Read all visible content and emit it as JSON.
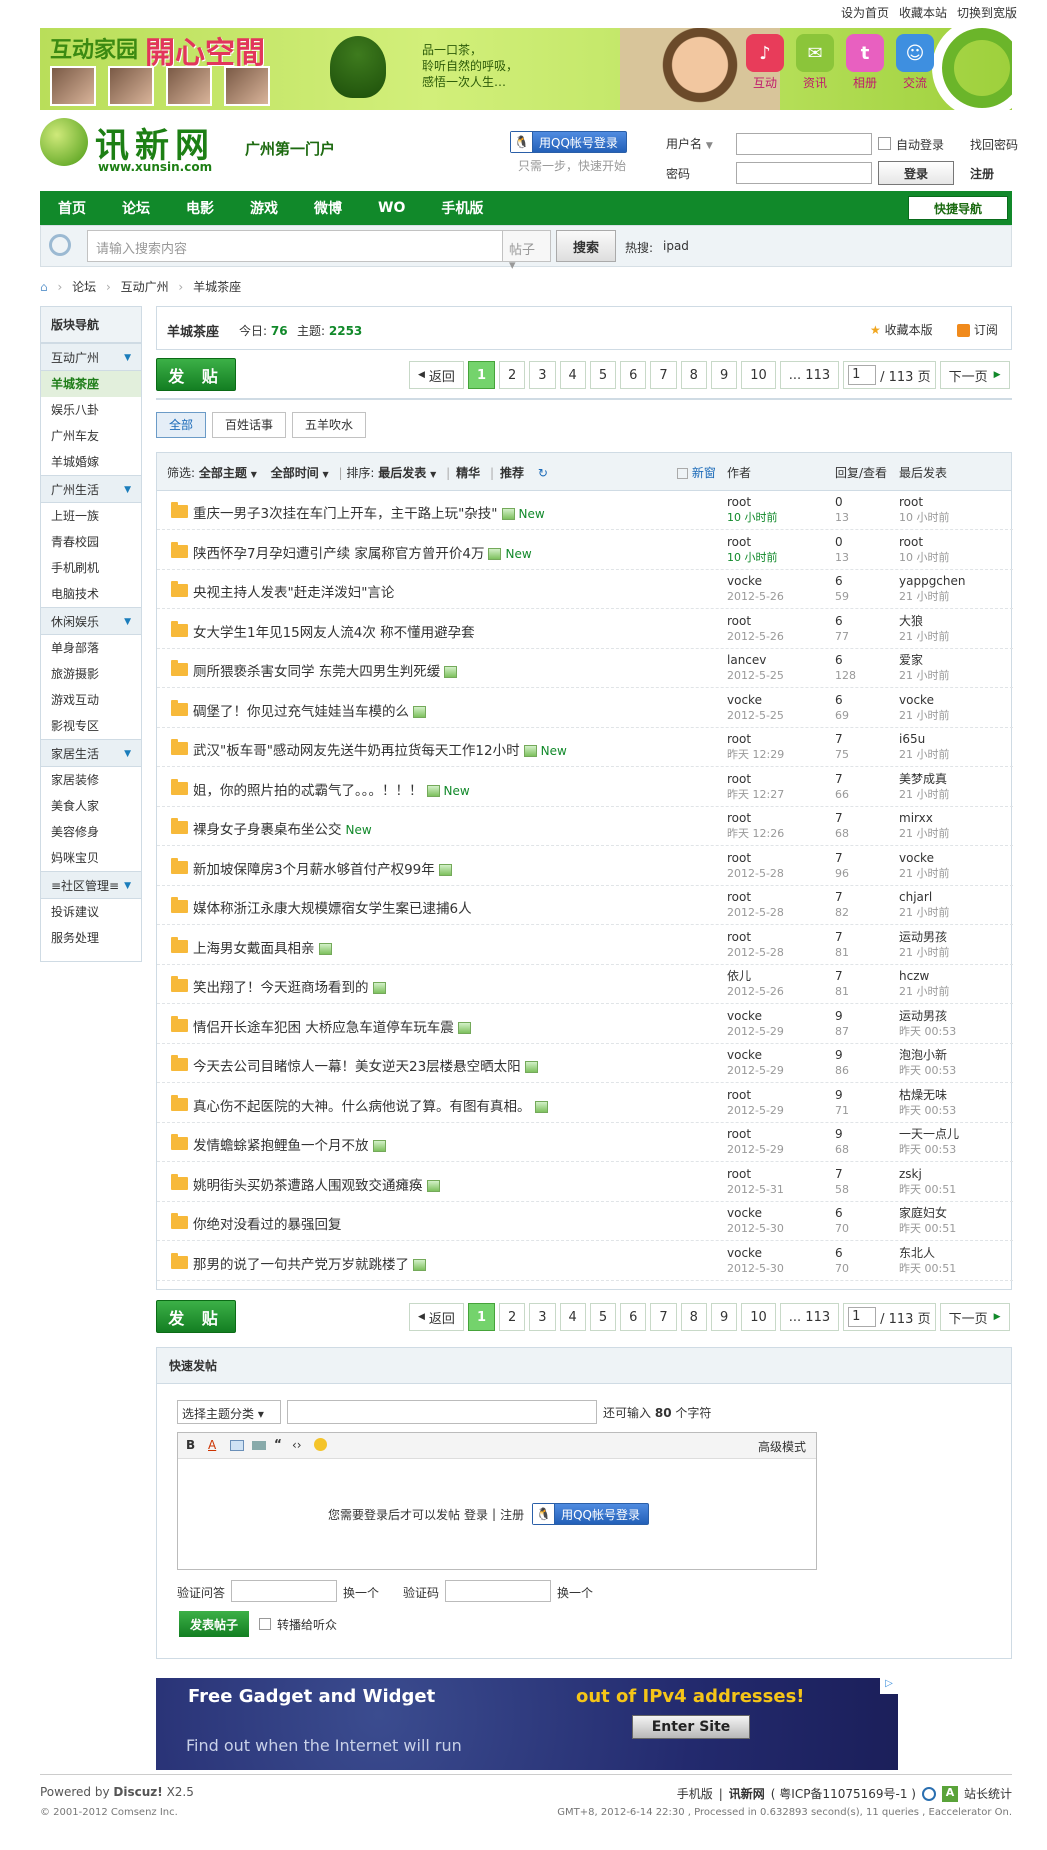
{
  "toplinks": [
    "设为首页",
    "收藏本站",
    "切换到宽版"
  ],
  "banner": {
    "title1": "互动家园",
    "title2": "開心空間",
    "slogan": [
      "品一口茶，",
      "聆听自然的呼吸，",
      "感悟一次人生…"
    ],
    "icons": [
      {
        "label": "互动",
        "color": "#e83c5a",
        "glyph": "♪",
        "icon": "clip-icon"
      },
      {
        "label": "资讯",
        "color": "#8bc53a",
        "glyph": "✉",
        "icon": "mail-icon"
      },
      {
        "label": "相册",
        "color": "#e860c0",
        "glyph": "t",
        "icon": "album-icon"
      },
      {
        "label": "交流",
        "color": "#3e8fe0",
        "glyph": "☺",
        "icon": "chat-icon"
      }
    ]
  },
  "logo": {
    "name": "讯新网",
    "url": "www.xunsin.com",
    "sub": "广州第一门户"
  },
  "login": {
    "qq_label": "用QQ帐号登录",
    "hint": "只需一步，快速开始",
    "username_label": "用户名",
    "password_label": "密码",
    "auto_login": "自动登录",
    "find_password": "找回密码",
    "login_btn": "登录",
    "register": "注册"
  },
  "nav": {
    "items": [
      "首页",
      "论坛",
      "电影",
      "游戏",
      "微博",
      "WO",
      "手机版"
    ],
    "quick": "快捷导航"
  },
  "search": {
    "placeholder": "请输入搜索内容",
    "type": "帖子",
    "button": "搜索",
    "hot_label": "热搜:",
    "hot": "ipad"
  },
  "crumb": [
    "论坛",
    "互动广州",
    "羊城茶座"
  ],
  "sidebar": {
    "title": "版块导航",
    "groups": [
      {
        "name": "互动广州",
        "items": [
          "羊城茶座",
          "娱乐八卦",
          "广州车友",
          "羊城婚嫁"
        ]
      },
      {
        "name": "广州生活",
        "items": [
          "上班一族",
          "青春校园",
          "手机刷机",
          "电脑技术"
        ]
      },
      {
        "name": "休闲娱乐",
        "items": [
          "单身部落",
          "旅游摄影",
          "游戏互动",
          "影视专区"
        ]
      },
      {
        "name": "家居生活",
        "items": [
          "家居装修",
          "美食人家",
          "美容修身",
          "妈咪宝贝"
        ]
      },
      {
        "name": "≡社区管理≡",
        "items": [
          "投诉建议",
          "服务处理"
        ]
      }
    ]
  },
  "forum": {
    "name": "羊城茶座",
    "today_label": "今日:",
    "today": "76",
    "topics_label": "主题:",
    "topics": "2253",
    "fav": "收藏本版",
    "rss": "订阅"
  },
  "post_btn": "发 贴",
  "pager": {
    "back": "返回",
    "pages": [
      "1",
      "2",
      "3",
      "4",
      "5",
      "6",
      "7",
      "8",
      "9",
      "10",
      "... 113"
    ],
    "page_input": "1",
    "total": "/ 113 页",
    "next": "下一页"
  },
  "tabs": [
    "全部",
    "百姓话事",
    "五羊吹水"
  ],
  "thead": {
    "filter": "筛选:",
    "all_topics": "全部主题",
    "all_time": "全部时间",
    "sort": "排序:",
    "latest": "最后发表",
    "digest": "精华",
    "recommend": "推荐",
    "newwin": "新窗",
    "author": "作者",
    "reply_view": "回复/查看",
    "lastpost": "最后发表"
  },
  "threads": [
    {
      "title": "重庆一男子3次挂在车门上开车，主干路上玩\"杂技\"",
      "img": true,
      "new": true,
      "author": "root",
      "date": "10 小时前",
      "dg": true,
      "replies": "0",
      "views": "13",
      "last": "root",
      "lastdate": "10 小时前"
    },
    {
      "title": "陕西怀孕7月孕妇遭引产续 家属称官方曾开价4万",
      "img": true,
      "new": true,
      "author": "root",
      "date": "10 小时前",
      "dg": true,
      "replies": "0",
      "views": "13",
      "last": "root",
      "lastdate": "10 小时前"
    },
    {
      "title": "央视主持人发表\"赶走洋泼妇\"言论",
      "img": false,
      "new": false,
      "author": "vocke",
      "date": "2012-5-26",
      "replies": "6",
      "views": "59",
      "last": "yappgchen",
      "lastdate": "21 小时前"
    },
    {
      "title": "女大学生1年见15网友人流4次 称不懂用避孕套",
      "img": false,
      "new": false,
      "author": "root",
      "date": "2012-5-26",
      "replies": "6",
      "views": "77",
      "last": "大狼",
      "lastdate": "21 小时前"
    },
    {
      "title": "厕所猥亵杀害女同学 东莞大四男生判死缓",
      "img": true,
      "new": false,
      "author": "lancev",
      "date": "2012-5-25",
      "replies": "6",
      "views": "128",
      "last": "爱家",
      "lastdate": "21 小时前"
    },
    {
      "title": "碉堡了！你见过充气娃娃当车模的么",
      "img": true,
      "new": false,
      "author": "vocke",
      "date": "2012-5-25",
      "replies": "6",
      "views": "69",
      "last": "vocke",
      "lastdate": "21 小时前"
    },
    {
      "title": "武汉\"板车哥\"感动网友先送牛奶再拉货每天工作12小时",
      "img": true,
      "new": true,
      "author": "root",
      "date": "昨天 12:29",
      "replies": "7",
      "views": "75",
      "last": "i65u",
      "lastdate": "21 小时前"
    },
    {
      "title": "姐，你的照片拍的忒霸气了。。。！！！",
      "img": true,
      "new": true,
      "author": "root",
      "date": "昨天 12:27",
      "replies": "7",
      "views": "66",
      "last": "美梦成真",
      "lastdate": "21 小时前"
    },
    {
      "title": "裸身女子身裹桌布坐公交",
      "img": false,
      "new": true,
      "author": "root",
      "date": "昨天 12:26",
      "replies": "7",
      "views": "68",
      "last": "mirxx",
      "lastdate": "21 小时前"
    },
    {
      "title": "新加坡保障房3个月薪水够首付产权99年",
      "img": true,
      "new": false,
      "author": "root",
      "date": "2012-5-28",
      "replies": "7",
      "views": "96",
      "last": "vocke",
      "lastdate": "21 小时前"
    },
    {
      "title": "媒体称浙江永康大规模嫖宿女学生案已逮捕6人",
      "img": false,
      "new": false,
      "author": "root",
      "date": "2012-5-28",
      "replies": "7",
      "views": "82",
      "last": "chjarl",
      "lastdate": "21 小时前"
    },
    {
      "title": "上海男女戴面具相亲",
      "img": true,
      "new": false,
      "author": "root",
      "date": "2012-5-28",
      "replies": "7",
      "views": "81",
      "last": "运动男孩",
      "lastdate": "21 小时前"
    },
    {
      "title": "笑出翔了！今天逛商场看到的",
      "img": true,
      "new": false,
      "author": "依儿",
      "date": "2012-5-26",
      "replies": "7",
      "views": "81",
      "last": "hczw",
      "lastdate": "21 小时前"
    },
    {
      "title": "情侣开长途车犯困 大桥应急车道停车玩车震",
      "img": true,
      "new": false,
      "author": "vocke",
      "date": "2012-5-29",
      "replies": "9",
      "views": "87",
      "last": "运动男孩",
      "lastdate": "昨天 00:53"
    },
    {
      "title": "今天去公司目睹惊人一幕！美女逆天23层楼悬空晒太阳",
      "img": true,
      "new": false,
      "author": "vocke",
      "date": "2012-5-29",
      "replies": "9",
      "views": "86",
      "last": "泡泡小新",
      "lastdate": "昨天 00:53"
    },
    {
      "title": "真心伤不起医院的大神。什么病他说了算。有图有真相。",
      "img": true,
      "new": false,
      "author": "root",
      "date": "2012-5-29",
      "replies": "9",
      "views": "71",
      "last": "枯燥无味",
      "lastdate": "昨天 00:53"
    },
    {
      "title": "发情蟾蜍紧抱鲤鱼一个月不放",
      "img": true,
      "new": false,
      "author": "root",
      "date": "2012-5-29",
      "replies": "9",
      "views": "68",
      "last": "一天一点儿",
      "lastdate": "昨天 00:53"
    },
    {
      "title": "姚明街头买奶茶遭路人围观致交通瘫痪",
      "img": true,
      "new": false,
      "author": "root",
      "date": "2012-5-31",
      "replies": "7",
      "views": "58",
      "last": "zskj",
      "lastdate": "昨天 00:51"
    },
    {
      "title": "你绝对没看过的暴强回复",
      "img": false,
      "new": false,
      "author": "vocke",
      "date": "2012-5-30",
      "replies": "6",
      "views": "70",
      "last": "家庭妇女",
      "lastdate": "昨天 00:51"
    },
    {
      "title": "那男的说了一句共产党万岁就跳楼了",
      "img": true,
      "new": false,
      "author": "vocke",
      "date": "2012-5-30",
      "replies": "6",
      "views": "70",
      "last": "东北人",
      "lastdate": "昨天 00:51"
    }
  ],
  "new_label": "New",
  "quickpost": {
    "title": "快速发帖",
    "category": "选择主题分类",
    "remain1": "还可输入",
    "remain_num": "80",
    "remain2": "个字符",
    "advanced": "高级模式",
    "login_hint": "您需要登录后才可以发帖",
    "login": "登录",
    "register": "注册",
    "qa_label": "验证问答",
    "change1": "换一个",
    "code_label": "验证码",
    "change2": "换一个",
    "submit": "发表帖子",
    "share": "转播给听众"
  },
  "ad": {
    "line1": "Free Gadget and Widget",
    "line2": "out of IPv4 addresses!",
    "line3": "Find out when the Internet will run",
    "button": "Enter Site"
  },
  "footer": {
    "powered": "Powered by",
    "brand": "Discuz!",
    "ver": "X2.5",
    "copy": "© 2001-2012 Comsenz Inc.",
    "links": [
      "手机版",
      "讯新网",
      "( 粤ICP备11075169号-1 )",
      "站长统计"
    ],
    "stats": "GMT+8, 2012-6-14 22:30 , Processed in 0.632893 second(s), 11 queries , Eaccelerator On."
  }
}
